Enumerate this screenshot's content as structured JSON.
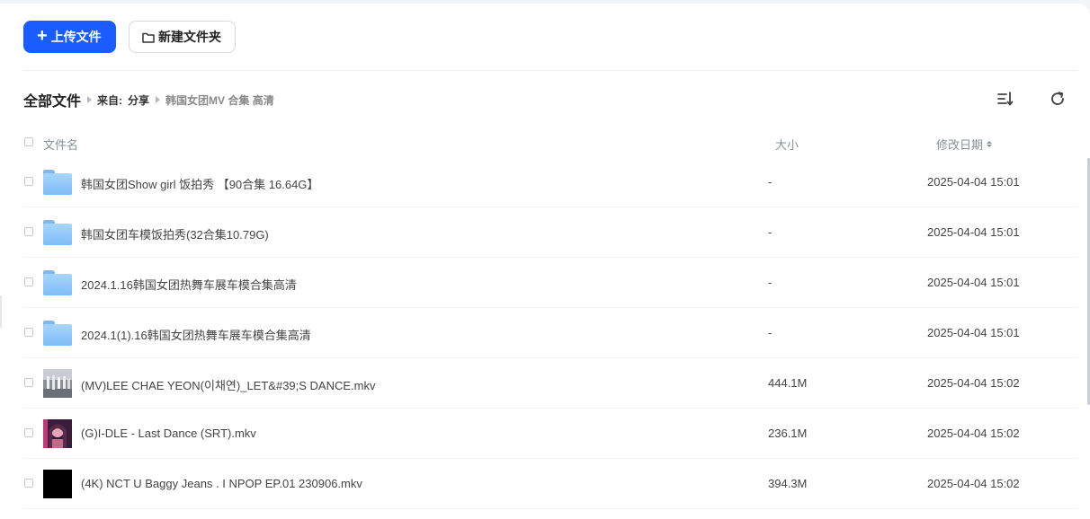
{
  "toolbar": {
    "upload_label": "上传文件",
    "new_folder_label": "新建文件夹"
  },
  "breadcrumb": {
    "root": "全部文件",
    "from": "来自:",
    "share": "分享",
    "current": "韩国女团MV 合集 高清"
  },
  "header": {
    "name": "文件名",
    "size": "大小",
    "date": "修改日期"
  },
  "files": [
    {
      "type": "folder",
      "name": "韩国女团Show girl 饭拍秀 【90合集 16.64G】",
      "size": "-",
      "date": "2025-04-04 15:01"
    },
    {
      "type": "folder",
      "name": "韩国女团车模饭拍秀(32合集10.79G)",
      "size": "-",
      "date": "2025-04-04 15:01"
    },
    {
      "type": "folder",
      "name": "2024.1.16韩国女团热舞车展车模合集高清",
      "size": "-",
      "date": "2025-04-04 15:01"
    },
    {
      "type": "folder",
      "name": "2024.1(1).16韩国女团热舞车展车模合集高清",
      "size": "-",
      "date": "2025-04-04 15:01"
    },
    {
      "type": "video",
      "name": "(MV)LEE CHAE YEON(이채연)_LET&#39;S DANCE.mkv",
      "size": "444.1M",
      "date": "2025-04-04 15:02"
    },
    {
      "type": "video",
      "name": "(G)I-DLE - Last Dance (SRT).mkv",
      "size": "236.1M",
      "date": "2025-04-04 15:02"
    },
    {
      "type": "video",
      "name": "(4K) NCT U Baggy Jeans . I NPOP EP.01 230906.mkv",
      "size": "394.3M",
      "date": "2025-04-04 15:02"
    }
  ],
  "colors": {
    "primary": "#1a5cff",
    "folder": "#8cc6fa"
  },
  "icons": [
    "plus-icon",
    "folder-outline-icon",
    "sort-list-icon",
    "refresh-icon",
    "folder-icon",
    "video-thumbnail"
  ]
}
